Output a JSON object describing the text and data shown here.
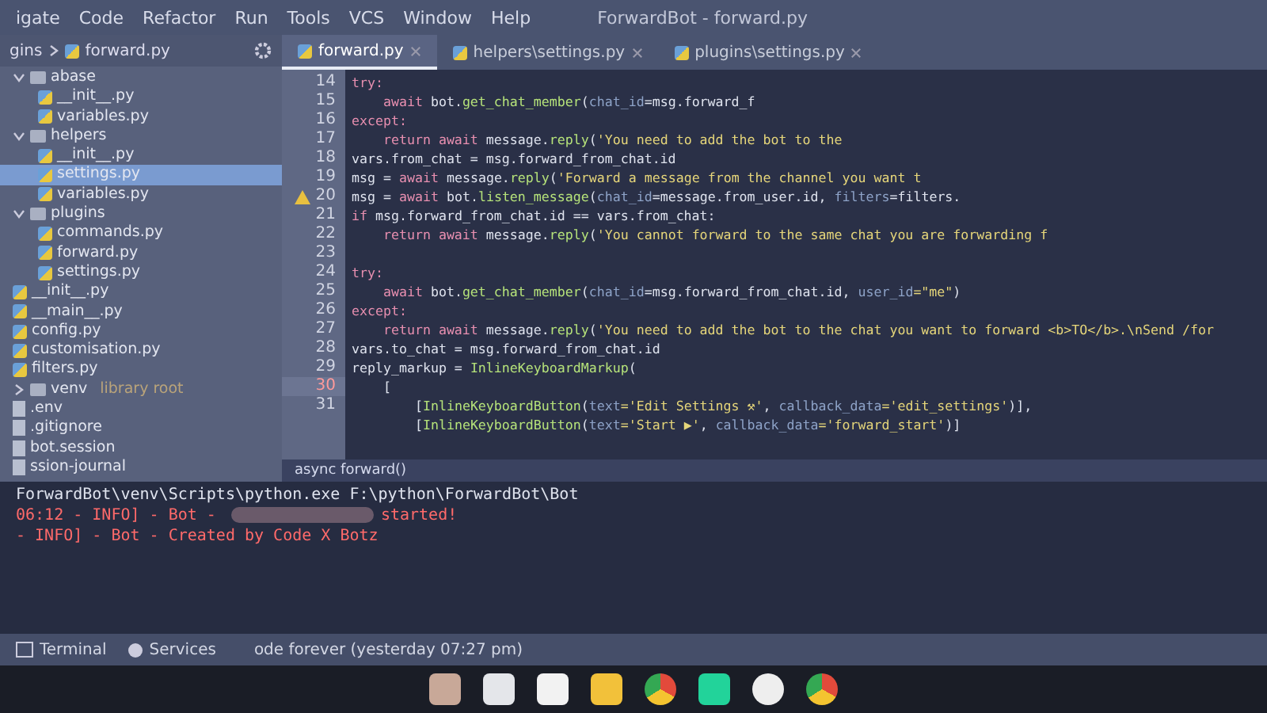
{
  "window": {
    "title": "ForwardBot - forward.py"
  },
  "menu": [
    "igate",
    "Code",
    "Refactor",
    "Run",
    "Tools",
    "VCS",
    "Window",
    "Help"
  ],
  "breadcrumb": [
    "gins",
    "forward.py"
  ],
  "tabs": [
    {
      "label": "forward.py",
      "selected": true
    },
    {
      "label": "helpers\\settings.py",
      "selected": false
    },
    {
      "label": "plugins\\settings.py",
      "selected": false
    }
  ],
  "project_tree": [
    {
      "label": "abase",
      "kind": "folder",
      "expanded": true,
      "selected": false,
      "children": [
        {
          "label": "__init__.py",
          "kind": "file",
          "selected": false
        },
        {
          "label": "variables.py",
          "kind": "file",
          "selected": false
        }
      ]
    },
    {
      "label": "helpers",
      "kind": "folder",
      "expanded": true,
      "selected": false,
      "children": [
        {
          "label": "__init__.py",
          "kind": "file",
          "selected": false
        },
        {
          "label": "settings.py",
          "kind": "file",
          "selected": true
        },
        {
          "label": "variables.py",
          "kind": "file",
          "selected": false
        }
      ]
    },
    {
      "label": "plugins",
      "kind": "folder",
      "expanded": true,
      "selected": false,
      "children": [
        {
          "label": "commands.py",
          "kind": "file",
          "selected": false
        },
        {
          "label": "forward.py",
          "kind": "file",
          "selected": false
        },
        {
          "label": "settings.py",
          "kind": "file",
          "selected": false
        }
      ]
    },
    {
      "label": "__init__.py",
      "kind": "file",
      "selected": false
    },
    {
      "label": "__main__.py",
      "kind": "file",
      "selected": false
    },
    {
      "label": "config.py",
      "kind": "file",
      "selected": false
    },
    {
      "label": "customisation.py",
      "kind": "file",
      "selected": false
    },
    {
      "label": "filters.py",
      "kind": "file",
      "selected": false
    },
    {
      "label": "venv",
      "kind": "folder",
      "expanded": false,
      "selected": false,
      "note": "library root"
    },
    {
      "label": ".env",
      "kind": "plain",
      "selected": false
    },
    {
      "label": ".gitignore",
      "kind": "plain",
      "selected": false
    },
    {
      "label": "bot.session",
      "kind": "plain",
      "selected": false
    },
    {
      "label": "ssion-journal",
      "kind": "plain",
      "selected": false
    }
  ],
  "gutter": [
    {
      "number": "14",
      "current": false
    },
    {
      "number": "15",
      "current": false
    },
    {
      "number": "16",
      "current": false
    },
    {
      "number": "17",
      "current": false
    },
    {
      "number": "18",
      "current": false
    },
    {
      "number": "19",
      "current": false
    },
    {
      "number": "20",
      "warning": true,
      "current": false
    },
    {
      "number": "21",
      "current": false
    },
    {
      "number": "22",
      "current": false
    },
    {
      "number": "23",
      "current": false
    },
    {
      "number": "24",
      "current": false
    },
    {
      "number": "25",
      "current": false
    },
    {
      "number": "26",
      "current": false
    },
    {
      "number": "27",
      "current": false
    },
    {
      "number": "28",
      "current": false
    },
    {
      "number": "29",
      "current": false
    },
    {
      "number": "30",
      "current": true
    },
    {
      "number": "31",
      "current": false
    }
  ],
  "code": [
    [
      {
        "kind": "kw",
        "text": "try:"
      }
    ],
    [
      {
        "kind": "kw",
        "text": "    await "
      },
      {
        "kind": "txt",
        "text": "bot."
      },
      {
        "kind": "fn",
        "text": "get_chat_member"
      },
      {
        "kind": "txt",
        "text": "("
      },
      {
        "kind": "prm",
        "text": "chat_id"
      },
      {
        "kind": "txt",
        "text": "=msg.forward_f"
      }
    ],
    [
      {
        "kind": "kw",
        "text": "except:"
      }
    ],
    [
      {
        "kind": "kw",
        "text": "    return await "
      },
      {
        "kind": "txt",
        "text": "message."
      },
      {
        "kind": "fn",
        "text": "reply"
      },
      {
        "kind": "txt",
        "text": "("
      },
      {
        "kind": "str",
        "text": "'You need to add the bot to the"
      }
    ],
    [
      {
        "kind": "txt",
        "text": "vars.from_chat = msg.forward_from_chat.id"
      }
    ],
    [
      {
        "kind": "txt",
        "text": "msg = "
      },
      {
        "kind": "kw",
        "text": "await "
      },
      {
        "kind": "txt",
        "text": "message."
      },
      {
        "kind": "fn",
        "text": "reply"
      },
      {
        "kind": "txt",
        "text": "("
      },
      {
        "kind": "str",
        "text": "'Forward a message from the channel you want t"
      }
    ],
    [
      {
        "kind": "txt",
        "text": "msg = "
      },
      {
        "kind": "kw",
        "text": "await "
      },
      {
        "kind": "txt",
        "text": "bot."
      },
      {
        "kind": "fn",
        "text": "listen_message"
      },
      {
        "kind": "txt",
        "text": "("
      },
      {
        "kind": "prm",
        "text": "chat_id"
      },
      {
        "kind": "txt",
        "text": "=message.from_user.id, "
      },
      {
        "kind": "prm",
        "text": "filters"
      },
      {
        "kind": "txt",
        "text": "=filters."
      }
    ],
    [
      {
        "kind": "kw",
        "text": "if "
      },
      {
        "kind": "txt",
        "text": "msg.forward_from_chat.id == vars.from_chat:"
      }
    ],
    [
      {
        "kind": "kw",
        "text": "    return await "
      },
      {
        "kind": "txt",
        "text": "message."
      },
      {
        "kind": "fn",
        "text": "reply"
      },
      {
        "kind": "txt",
        "text": "("
      },
      {
        "kind": "str",
        "text": "'You cannot forward to the same chat you are forwarding f"
      }
    ],
    [
      {
        "kind": "kw",
        "text": "try:",
        "space_before": true
      }
    ],
    [
      {
        "kind": "kw",
        "text": "    await "
      },
      {
        "kind": "txt",
        "text": "bot."
      },
      {
        "kind": "fn",
        "text": "get_chat_member"
      },
      {
        "kind": "txt",
        "text": "("
      },
      {
        "kind": "prm",
        "text": "chat_id"
      },
      {
        "kind": "txt",
        "text": "=msg.forward_from_chat.id, "
      },
      {
        "kind": "prm",
        "text": "user_id"
      },
      {
        "kind": "str",
        "text": "=\"me\""
      },
      {
        "kind": "txt",
        "text": ")"
      }
    ],
    [
      {
        "kind": "kw",
        "text": "except:"
      }
    ],
    [
      {
        "kind": "kw",
        "text": "    return await "
      },
      {
        "kind": "txt",
        "text": "message."
      },
      {
        "kind": "fn",
        "text": "reply"
      },
      {
        "kind": "txt",
        "text": "("
      },
      {
        "kind": "str",
        "text": "'You need to add the bot to the chat you want to forward <b>TO</b>.\\nSend /for"
      }
    ],
    [
      {
        "kind": "txt",
        "text": "vars.to_chat = msg.forward_from_chat.id"
      }
    ],
    [
      {
        "kind": "txt",
        "text": "reply_markup = "
      },
      {
        "kind": "fn",
        "text": "InlineKeyboardMarkup"
      },
      {
        "kind": "txt",
        "text": "("
      }
    ],
    [
      {
        "kind": "txt",
        "text": "    ["
      }
    ],
    [
      {
        "kind": "txt",
        "text": "        ["
      },
      {
        "kind": "fn",
        "text": "InlineKeyboardButton"
      },
      {
        "kind": "txt",
        "text": "("
      },
      {
        "kind": "prm",
        "text": "text"
      },
      {
        "kind": "str",
        "text": "='Edit Settings ⚒'"
      },
      {
        "kind": "txt",
        "text": ", "
      },
      {
        "kind": "prm",
        "text": "callback_data"
      },
      {
        "kind": "str",
        "text": "='edit_settings'"
      },
      {
        "kind": "txt",
        "text": ")],"
      }
    ],
    [
      {
        "kind": "txt",
        "text": "        ["
      },
      {
        "kind": "fn",
        "text": "InlineKeyboardButton"
      },
      {
        "kind": "txt",
        "text": "("
      },
      {
        "kind": "prm",
        "text": "text"
      },
      {
        "kind": "str",
        "text": "='Start ▶'"
      },
      {
        "kind": "txt",
        "text": ", "
      },
      {
        "kind": "prm",
        "text": "callback_data"
      },
      {
        "kind": "str",
        "text": "='forward_start'"
      },
      {
        "kind": "txt",
        "text": ")]"
      }
    ]
  ],
  "editor_breadcrumb": "async forward()",
  "terminal": {
    "command": "ForwardBot\\venv\\Scripts\\python.exe F:\\python\\ForwardBot\\Bot",
    "lines": [
      {
        "parts": [
          "06:12 - INFO] - Bot - ",
          "started!"
        ],
        "redacted": true
      },
      {
        "parts": [
          "- INFO] - Bot - Created by Code X Botz"
        ]
      }
    ]
  },
  "status_bar": {
    "tools": [
      {
        "label": "Terminal",
        "kind": "terminal"
      },
      {
        "label": "Services",
        "kind": "services"
      }
    ],
    "message": "ode forever (yesterday 07:27 pm)"
  },
  "taskbar": [
    {
      "kind": "photo"
    },
    {
      "kind": "files"
    },
    {
      "kind": "calendar"
    },
    {
      "kind": "folder"
    },
    {
      "kind": "browser"
    },
    {
      "kind": "ide"
    },
    {
      "kind": "media"
    },
    {
      "kind": "browser"
    }
  ]
}
